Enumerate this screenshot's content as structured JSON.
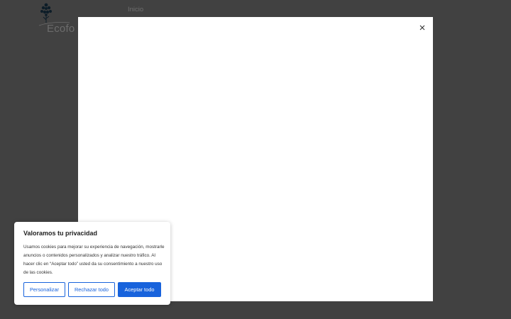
{
  "header": {
    "logo_text": "Ecofo",
    "nav": {
      "home_label": "Inicio"
    }
  },
  "modal": {
    "close_icon": "close-icon"
  },
  "cookie_banner": {
    "title": "Valoramos tu privacidad",
    "text": "Usamos cookies para mejorar su experiencia de navegación, mostrarle anuncios o contenidos personalizados y analizar nuestro tráfico. Al hacer clic en “Aceptar todo” usted da su consentimiento a nuestro uso de las cookies.",
    "customize_label": "Personalizar",
    "reject_label": "Rechazar todo",
    "accept_label": "Aceptar todo"
  },
  "colors": {
    "overlay": "#414141",
    "accent": "#1863dc",
    "modal_bg": "#ffffff"
  }
}
